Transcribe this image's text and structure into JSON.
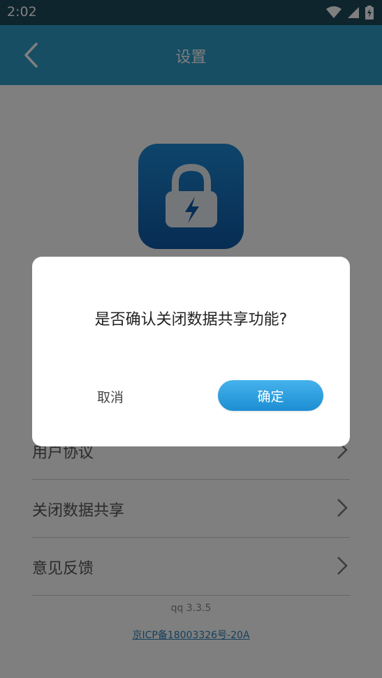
{
  "status_bar": {
    "time": "2:02",
    "icons": [
      "wifi-icon",
      "cellular-signal-icon",
      "battery-charging-icon"
    ]
  },
  "app_bar": {
    "title": "设置",
    "back_icon": "chevron-left-icon",
    "background": "#2e9dc8"
  },
  "app_icon": {
    "name": "lock-bolt-icon",
    "colors": [
      "#1e8ad6",
      "#0f5aa8"
    ]
  },
  "menu": {
    "items": [
      {
        "label": "用户协议",
        "icon": "chevron-right-icon"
      },
      {
        "label": "关闭数据共享",
        "icon": "chevron-right-icon"
      },
      {
        "label": "意见反馈",
        "icon": "chevron-right-icon"
      }
    ]
  },
  "footer": {
    "version": "qq 3.3.5",
    "icp": "京ICP备18003326号-20A"
  },
  "dialog": {
    "message": "是否确认关闭数据共享功能?",
    "cancel_label": "取消",
    "confirm_label": "确定",
    "confirm_color": "#2a9be0"
  }
}
